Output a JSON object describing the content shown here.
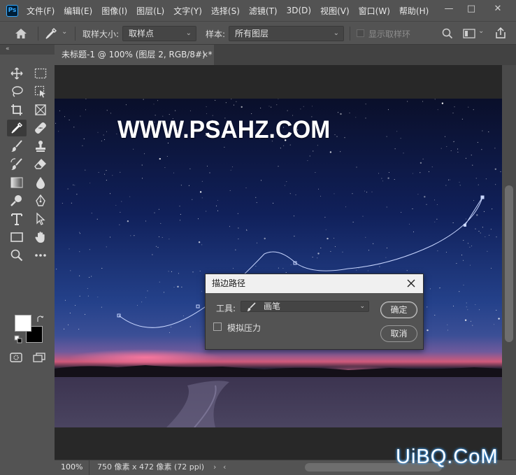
{
  "app": {
    "logo_text": "Ps"
  },
  "menu": [
    "文件(F)",
    "编辑(E)",
    "图像(I)",
    "图层(L)",
    "文字(Y)",
    "选择(S)",
    "滤镜(T)",
    "3D(D)",
    "视图(V)",
    "窗口(W)",
    "帮助(H)"
  ],
  "window_controls": {
    "minimize": "—",
    "maximize": "□",
    "close": "✕"
  },
  "options_bar": {
    "sample_size_label": "取样大小:",
    "sample_size_value": "取样点",
    "sample_label": "样本:",
    "sample_value": "所有图层",
    "show_ring_label": "显示取样环"
  },
  "panel": {
    "collapse_glyph": "«"
  },
  "document": {
    "tab_title": "未标题-1 @ 100% (图层 2, RGB/8#) *",
    "tab_close": "✕"
  },
  "tools": {
    "active": "eyedropper-tool",
    "list": [
      "move",
      "marquee",
      "lasso",
      "quick-select",
      "crop",
      "frame",
      "eyedropper",
      "healing",
      "brush",
      "stamp",
      "history-brush",
      "eraser",
      "gradient",
      "blur",
      "dodge",
      "pen",
      "type",
      "path-select",
      "rectangle",
      "hand",
      "zoom",
      "more"
    ]
  },
  "colors": {
    "foreground": "#ffffff",
    "background": "#000000",
    "accent": "#31a8ff",
    "path": "#c8d6ff"
  },
  "canvas": {
    "watermark": "WWW.PSAHZ.COM"
  },
  "dialog": {
    "title": "描边路径",
    "tool_label": "工具:",
    "tool_value": "画笔",
    "simulate_pressure_label": "模拟压力",
    "simulate_pressure_checked": false,
    "ok_label": "确定",
    "cancel_label": "取消"
  },
  "status": {
    "zoom": "100%",
    "info": "750 像素 x 472 像素 (72 ppi)",
    "arrow_right": "›",
    "arrow_left": "‹"
  },
  "watermark_bottom": "UiBQ.CoM"
}
